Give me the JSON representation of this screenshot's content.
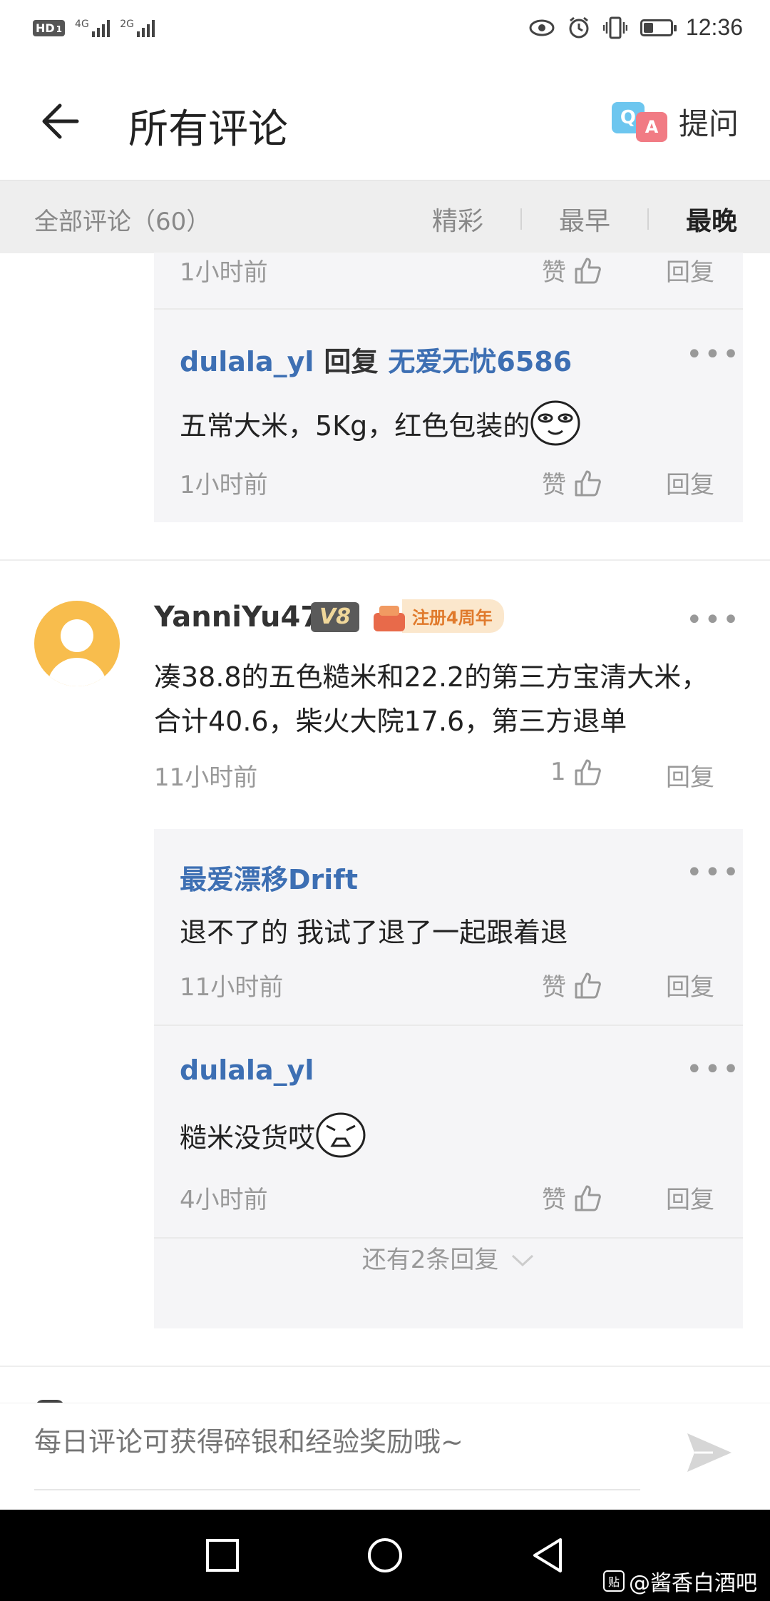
{
  "status_bar": {
    "hd_label": "HD",
    "hd_sub": "1",
    "net1": "4G",
    "net2": "2G",
    "time": "12:36",
    "battery_level": 0.35
  },
  "header": {
    "title": "所有评论",
    "ask_label": "提问",
    "qa_q": "Q",
    "qa_a": "A"
  },
  "filter_bar": {
    "all_comments": "全部评论（60）",
    "tabs": [
      "精彩",
      "最早",
      "最晚"
    ],
    "active_tab": "最晚"
  },
  "thread_top": {
    "partial_reply": {
      "time": "1小时前",
      "like_label": "赞",
      "reply_label": "回复"
    },
    "reply": {
      "user": "dulala_yl",
      "reply_word": "回复",
      "reply_to": "无爱无忧6586",
      "text": "五常大米，5Kg，红色包装的",
      "time": "1小时前",
      "like_label": "赞",
      "reply_label": "回复"
    }
  },
  "comment": {
    "username": "YanniYu47",
    "level": "V8",
    "anniversary": "注册4周年",
    "text": "凑38.8的五色糙米和22.2的第三方宝清大米，合计40.6，柴火大院17.6，第三方退单",
    "time": "11小时前",
    "likes": "1",
    "reply_label": "回复",
    "replies": [
      {
        "user": "最爱漂移Drift",
        "text": "退不了的 我试了退了一起跟着退",
        "time": "11小时前",
        "like_label": "赞",
        "reply_label": "回复"
      },
      {
        "user": "dulala_yl",
        "text": "糙米没货哎",
        "time": "4小时前",
        "like_label": "赞",
        "reply_label": "回复"
      }
    ],
    "more_replies": "还有2条回复"
  },
  "input_bar": {
    "placeholder": "每日评论可获得碎银和经验奖励哦~"
  },
  "watermark": "@酱香白酒吧",
  "watermark_icon": "贴"
}
